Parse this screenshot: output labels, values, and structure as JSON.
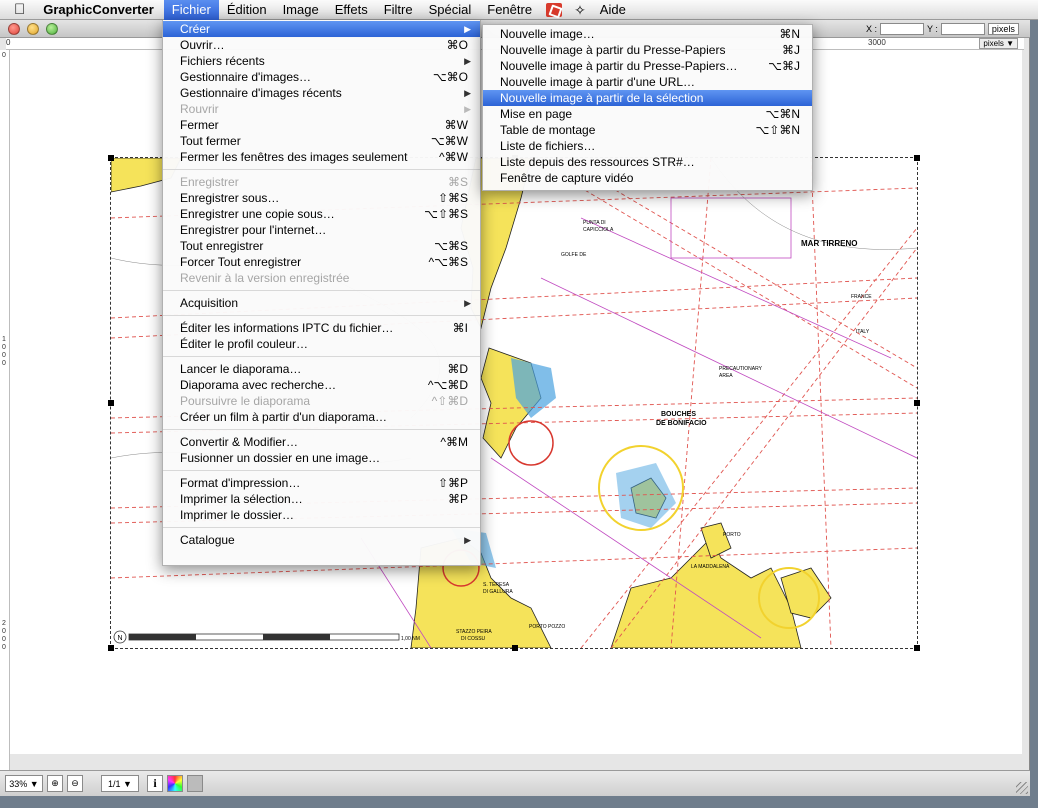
{
  "menubar": {
    "apple": "",
    "app_name": "GraphicConverter",
    "menus": [
      "Fichier",
      "Édition",
      "Image",
      "Effets",
      "Filtre",
      "Spécial",
      "Fenêtre",
      "Aide"
    ]
  },
  "window": {
    "coords": {
      "x_label": "X :",
      "x_value": "",
      "y_label": "Y :",
      "y_value": "",
      "units": "pixels"
    },
    "ruler_top_labels": [
      "0",
      "3000"
    ],
    "ruler_unit": "pixels ▼",
    "ruler_left_labels": [
      "0",
      "1000",
      "2000"
    ]
  },
  "file_menu": {
    "items": [
      {
        "label": "Créer",
        "shortcut": "",
        "submenu": true,
        "selected": true
      },
      {
        "label": "Ouvrir…",
        "shortcut": "⌘O"
      },
      {
        "label": "Fichiers récents",
        "shortcut": "",
        "submenu": true
      },
      {
        "label": "Gestionnaire d'images…",
        "shortcut": "⌥⌘O"
      },
      {
        "label": "Gestionnaire d'images récents",
        "shortcut": "",
        "submenu": true
      },
      {
        "label": "Rouvrir",
        "shortcut": "",
        "submenu": true,
        "disabled": true
      },
      {
        "label": "Fermer",
        "shortcut": "⌘W"
      },
      {
        "label": "Tout fermer",
        "shortcut": "⌥⌘W"
      },
      {
        "label": "Fermer les fenêtres des images seulement",
        "shortcut": "^⌘W"
      },
      {
        "separator": true
      },
      {
        "label": "Enregistrer",
        "shortcut": "⌘S",
        "disabled": true
      },
      {
        "label": "Enregistrer sous…",
        "shortcut": "⇧⌘S"
      },
      {
        "label": "Enregistrer une copie sous…",
        "shortcut": "⌥⇧⌘S"
      },
      {
        "label": "Enregistrer pour l'internet…",
        "shortcut": ""
      },
      {
        "label": "Tout enregistrer",
        "shortcut": "⌥⌘S"
      },
      {
        "label": "Forcer Tout enregistrer",
        "shortcut": "^⌥⌘S"
      },
      {
        "label": "Revenir à la version enregistrée",
        "shortcut": "",
        "disabled": true
      },
      {
        "separator": true
      },
      {
        "label": "Acquisition",
        "shortcut": "",
        "submenu": true
      },
      {
        "separator": true
      },
      {
        "label": "Éditer les informations IPTC du fichier…",
        "shortcut": "⌘I"
      },
      {
        "label": "Éditer le profil couleur…",
        "shortcut": ""
      },
      {
        "separator": true
      },
      {
        "label": "Lancer le diaporama…",
        "shortcut": "⌘D"
      },
      {
        "label": "Diaporama avec recherche…",
        "shortcut": "^⌥⌘D"
      },
      {
        "label": "Poursuivre le diaporama",
        "shortcut": "^⇧⌘D",
        "disabled": true
      },
      {
        "label": "Créer un film à partir d'un diaporama…",
        "shortcut": ""
      },
      {
        "separator": true
      },
      {
        "label": "Convertir & Modifier…",
        "shortcut": "^⌘M"
      },
      {
        "label": "Fusionner un dossier en une image…",
        "shortcut": ""
      },
      {
        "separator": true
      },
      {
        "label": "Format d'impression…",
        "shortcut": "⇧⌘P"
      },
      {
        "label": "Imprimer la sélection…",
        "shortcut": "⌘P"
      },
      {
        "label": "Imprimer le dossier…",
        "shortcut": ""
      },
      {
        "separator": true
      },
      {
        "label": "Catalogue",
        "shortcut": "",
        "submenu": true
      }
    ]
  },
  "create_submenu": {
    "items": [
      {
        "label": "Nouvelle image…",
        "shortcut": "⌘N"
      },
      {
        "label": "Nouvelle image à partir du Presse-Papiers",
        "shortcut": "⌘J"
      },
      {
        "label": "Nouvelle image à partir du Presse-Papiers…",
        "shortcut": "⌥⌘J"
      },
      {
        "label": "Nouvelle image à partir d'une URL…",
        "shortcut": ""
      },
      {
        "label": "Nouvelle image à partir de la sélection",
        "shortcut": "",
        "selected": true
      },
      {
        "label": "Mise en page",
        "shortcut": "⌥⌘N"
      },
      {
        "label": "Table de montage",
        "shortcut": "⌥⇧⌘N"
      },
      {
        "label": "Liste de fichiers…",
        "shortcut": ""
      },
      {
        "label": "Liste depuis des ressources STR#…",
        "shortcut": ""
      },
      {
        "label": "Fenêtre de capture vidéo",
        "shortcut": ""
      }
    ]
  },
  "map": {
    "labels": [
      "MAR TIRRENO",
      "BOUCHES",
      "DE BONIFACIO",
      "PRECAUTIONARY",
      "AREA",
      "FRANCE",
      "ITALY",
      "LA MADDALENA",
      "PORTO",
      "S. TERESA",
      "DI GALLURA",
      "PUNTA DI",
      "CAPICCIOLA",
      "GOLFE DE",
      "PORTO POZZO",
      "STAZZO PEIRA",
      "DI COSSU"
    ],
    "scale_label": "1,00 NM"
  },
  "statusbar": {
    "zoom": "33% ▼",
    "page": "1/1 ▼",
    "info": "i"
  }
}
